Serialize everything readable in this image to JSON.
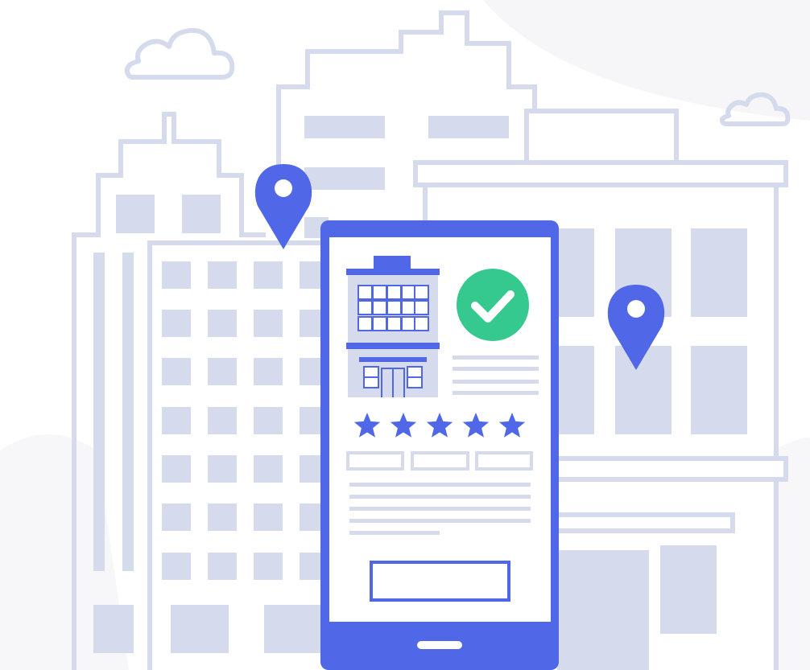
{
  "illustration": {
    "subject": "hotel-booking-app",
    "colors": {
      "outline": "#d5dbec",
      "window_fill": "#d5dbec",
      "phone": "#5068e8",
      "check": "#35c98f",
      "background_blob": "#f6f6f9"
    },
    "phone": {
      "rating_stars": 5,
      "rating_max": 5,
      "status_icon": "check-circle-icon",
      "tabs_count": 3
    },
    "map_pins": [
      "map-pin-icon",
      "map-pin-icon"
    ]
  }
}
